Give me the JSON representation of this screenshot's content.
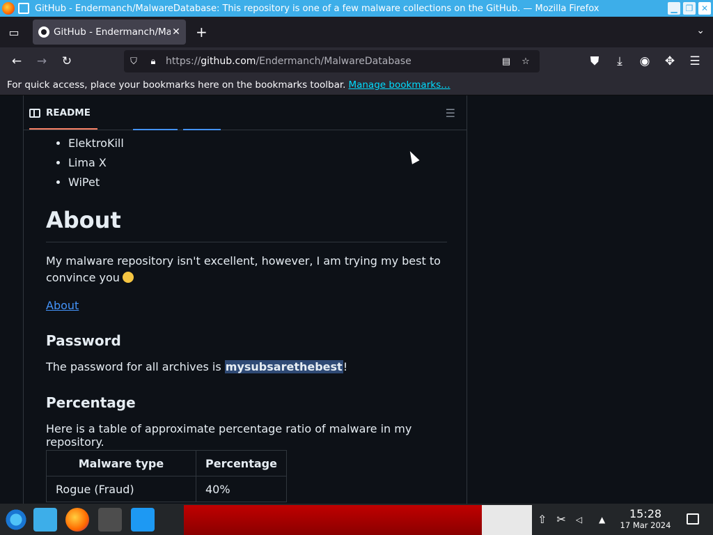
{
  "window": {
    "title": "GitHub - Endermanch/MalwareDatabase: This repository is one of a few malware collections on the GitHub. — Mozilla Firefox"
  },
  "tab": {
    "label": "GitHub - Endermanch/Ma",
    "close": "✕"
  },
  "navbar": {
    "url_prefix": "https://",
    "url_host": "github.com",
    "url_path": "/Endermanch/MalwareDatabase"
  },
  "bookmarks": {
    "hint": "For quick access, place your bookmarks here on the bookmarks toolbar.",
    "manage_link": "Manage bookmarks…"
  },
  "readme": {
    "tab_label": "README",
    "list_items": [
      "ElektroKill",
      "Lima X",
      "WiPet"
    ],
    "about_heading": "About",
    "about_text": "My malware repository isn't excellent, however, I am trying my best to convince you",
    "about_link": "About",
    "password_heading": "Password",
    "password_text_before": "The password for all archives is ",
    "password_value": "mysubsarethebest",
    "password_text_after": "!",
    "percentage_heading": "Percentage",
    "percentage_text": "Here is a table of approximate percentage ratio of malware in my repository.",
    "table": {
      "headers": [
        "Malware type",
        "Percentage"
      ],
      "rows": [
        [
          "Rogue (Fraud)",
          "40%"
        ]
      ]
    }
  },
  "taskbar": {
    "time": "15:28",
    "date": "17 Mar 2024"
  },
  "colors": {
    "titlebar": "#3daee9",
    "link": "#4493f8",
    "highlight": "#2f4a75"
  }
}
